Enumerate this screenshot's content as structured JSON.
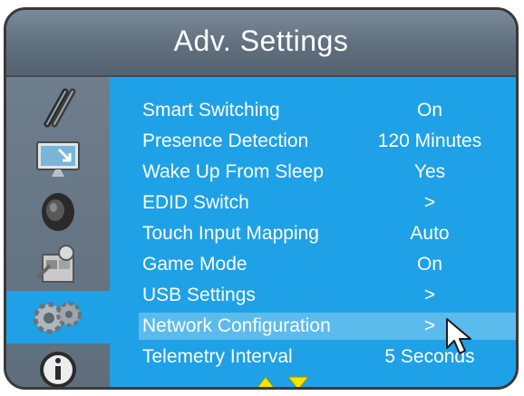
{
  "header": {
    "title": "Adv. Settings"
  },
  "sidebar": {
    "items": [
      {
        "icon": "cables-icon"
      },
      {
        "icon": "display-icon"
      },
      {
        "icon": "speaker-icon"
      },
      {
        "icon": "toolbox-icon"
      },
      {
        "icon": "gears-icon",
        "active": true
      },
      {
        "icon": "info-icon"
      }
    ]
  },
  "menu": {
    "rows": [
      {
        "label": "Smart Switching",
        "value": "On"
      },
      {
        "label": "Presence Detection",
        "value": "120 Minutes"
      },
      {
        "label": "Wake Up From Sleep",
        "value": "Yes"
      },
      {
        "label": "EDID Switch",
        "value": ">"
      },
      {
        "label": "Touch Input Mapping",
        "value": "Auto"
      },
      {
        "label": "Game Mode",
        "value": "On"
      },
      {
        "label": "USB Settings",
        "value": ">"
      },
      {
        "label": "Network Configuration",
        "value": ">",
        "highlighted": true
      },
      {
        "label": "Telemetry Interval",
        "value": "5 Seconds"
      }
    ]
  },
  "colors": {
    "accent": "#1ea1e6",
    "header": "#6b7b8a",
    "arrow": "#f4e400"
  }
}
